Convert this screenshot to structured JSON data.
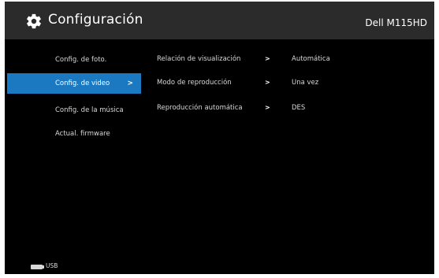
{
  "header": {
    "title": "Configuración",
    "model": "Dell M115HD"
  },
  "menu": [
    {
      "label": "Config. de foto."
    },
    {
      "label": "Config. de video",
      "selected": true
    },
    {
      "label": "Config. de la música"
    },
    {
      "label": "Actual. firmware"
    }
  ],
  "settings": [
    {
      "label": "Relación de visualización",
      "value": "Automática"
    },
    {
      "label": "Modo de reproducción",
      "value": "Una vez"
    },
    {
      "label": "Reproducción automática",
      "value": "DES"
    }
  ],
  "arrow_glyph": ">",
  "footer": {
    "source": "USB"
  },
  "colors": {
    "accent": "#1b79c2",
    "background": "#000000",
    "header": "#2b2b2b"
  }
}
